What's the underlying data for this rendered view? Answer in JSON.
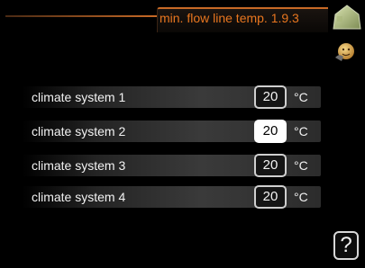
{
  "header": {
    "title": "min. flow line temp. 1.9.3",
    "home_icon": "home-icon",
    "status_icon": "face-icon",
    "accent_color": "#e8761f"
  },
  "rows": [
    {
      "label": "climate system 1",
      "value": "20",
      "unit": "°C",
      "selected": false
    },
    {
      "label": "climate system 2",
      "value": "20",
      "unit": "°C",
      "selected": true
    },
    {
      "label": "climate system 3",
      "value": "20",
      "unit": "°C",
      "selected": false
    },
    {
      "label": "climate system 4",
      "value": "20",
      "unit": "°C",
      "selected": false
    }
  ],
  "help": {
    "label": "?",
    "icon": "help-icon"
  }
}
